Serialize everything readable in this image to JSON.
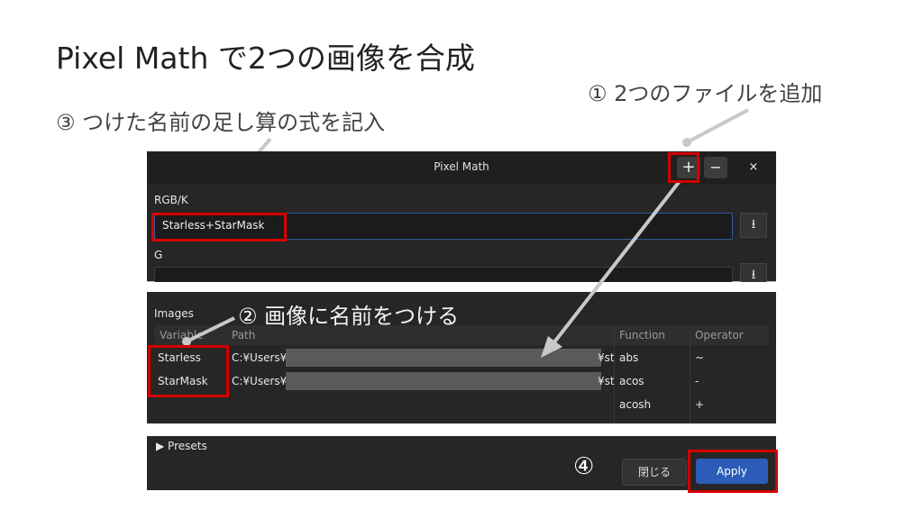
{
  "slide": {
    "title": "Pixel Math で2つの画像を合成",
    "note1": "① 2つのファイルを追加",
    "note2": "② 画像に名前をつける",
    "note3": "③ つけた名前の足し算の式を記入",
    "note4": "④"
  },
  "window": {
    "title": "Pixel Math",
    "add_label": "+",
    "remove_label": "−",
    "close_label": "×"
  },
  "expressions": {
    "rgbk_label": "RGB/K",
    "rgbk_value": "Starless+StarMask",
    "g_label": "G",
    "download_glyph": "⭳"
  },
  "images": {
    "section_label": "Images",
    "columns": {
      "variable": "Variable",
      "path": "Path"
    },
    "rows": [
      {
        "variable": "Starless",
        "path_start": "C:¥Users¥",
        "path_end": "¥sta"
      },
      {
        "variable": "StarMask",
        "path_start": "C:¥Users¥",
        "path_end": "¥sta"
      }
    ]
  },
  "functions": {
    "columns": {
      "function": "Function",
      "operator": "Operator"
    },
    "rows": [
      {
        "function": "abs",
        "operator": "~"
      },
      {
        "function": "acos",
        "operator": "-"
      },
      {
        "function": "acosh",
        "operator": "+"
      }
    ]
  },
  "footer": {
    "presets_label": "▶ Presets",
    "close_button": "閉じる",
    "apply_button": "Apply"
  },
  "colors": {
    "highlight": "#d40000",
    "apply": "#2a5cb8",
    "panel": "#262626"
  }
}
